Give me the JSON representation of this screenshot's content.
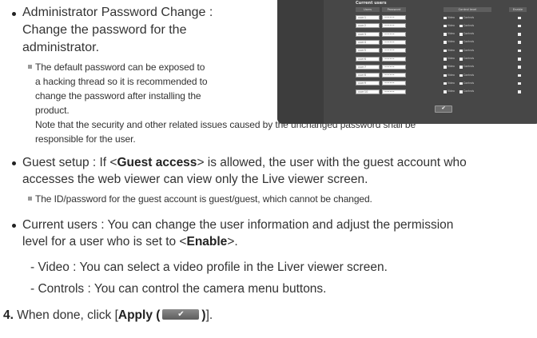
{
  "admin_pw": {
    "label": "Administrator Password Change",
    "sep": " :",
    "desc_lines": [
      "Change the password for the",
      "administrator."
    ],
    "note_lines": [
      "The default password can be exposed to",
      "a hacking thread so it is recommended to",
      "change the password after installing the",
      "product."
    ],
    "extra_lines": [
      "Note that the security and other related issues caused by the unchanged password shall be",
      "responsible for the user."
    ]
  },
  "guest": {
    "line1_prefix": "Guest setup : If <",
    "line1_bold": "Guest access",
    "line1_suffix": "> is allowed, the user with the guest account who",
    "line2": "accesses the web viewer can view only the Live viewer screen.",
    "note": "The ID/password for the guest account is guest/guest, which cannot be changed."
  },
  "current_users": {
    "line1": "Current users : You can change the user information and adjust the permission",
    "line2_prefix": "level for a user who is set to <",
    "line2_bold": "Enable",
    "line2_suffix": ">.",
    "sub_video": "- Video : You can select a video profile in the Liver viewer screen.",
    "sub_controls": "- Controls : You can control the camera menu buttons."
  },
  "step4": {
    "number": "4.",
    "text": " When done, click [",
    "bold": "Apply (",
    "bold_end": ")",
    "end": "]."
  },
  "screenshot": {
    "title": "Current users",
    "headers": [
      "Users",
      "Password",
      "Control level",
      "Enable"
    ],
    "users": [
      "user1",
      "user2",
      "user3",
      "user4",
      "user5",
      "user6",
      "user7",
      "user8",
      "user9",
      "user10"
    ],
    "password_mask": "••••••",
    "video_label": "Video",
    "controls_label": "Controls",
    "apply_glyph": "✔"
  },
  "colors": {
    "panel_bg": "#474747",
    "text": "#333333"
  }
}
